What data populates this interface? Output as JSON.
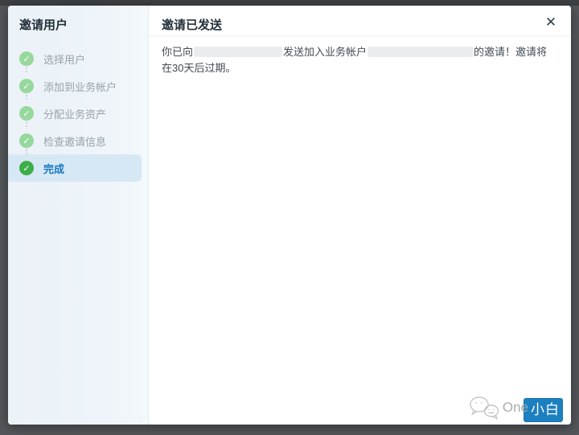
{
  "dialog": {
    "sidebar": {
      "title": "邀请用户",
      "steps": [
        {
          "label": "选择用户",
          "state": "done"
        },
        {
          "label": "添加到业务帐户",
          "state": "done"
        },
        {
          "label": "分配业务资产",
          "state": "done"
        },
        {
          "label": "检查邀请信息",
          "state": "done"
        },
        {
          "label": "完成",
          "state": "active"
        }
      ]
    },
    "main": {
      "title": "邀请已发送",
      "close_icon": "✕",
      "body": {
        "segment_before": "你已向",
        "segment_middle": "发送加入业务帐户",
        "segment_after": "的邀请！邀请将",
        "line2": "在30天后过期。"
      }
    },
    "footer": {
      "button_label": "",
      "watermark": {
        "icon": "wechat-icon",
        "text_gray": "One",
        "text_on_button": "小白"
      }
    }
  },
  "icons": {
    "check": "✓"
  },
  "colors": {
    "accent_blue": "#1c7fc0",
    "active_text_blue": "#1878bf",
    "step_done_green": "#97d89c",
    "step_active_green": "#3bad49",
    "sidebar_bg": "#ebf2f8",
    "active_row_bg": "#d7e8f5",
    "redaction_gray": "#e9edf0",
    "chrome_gray": "#53565a"
  }
}
